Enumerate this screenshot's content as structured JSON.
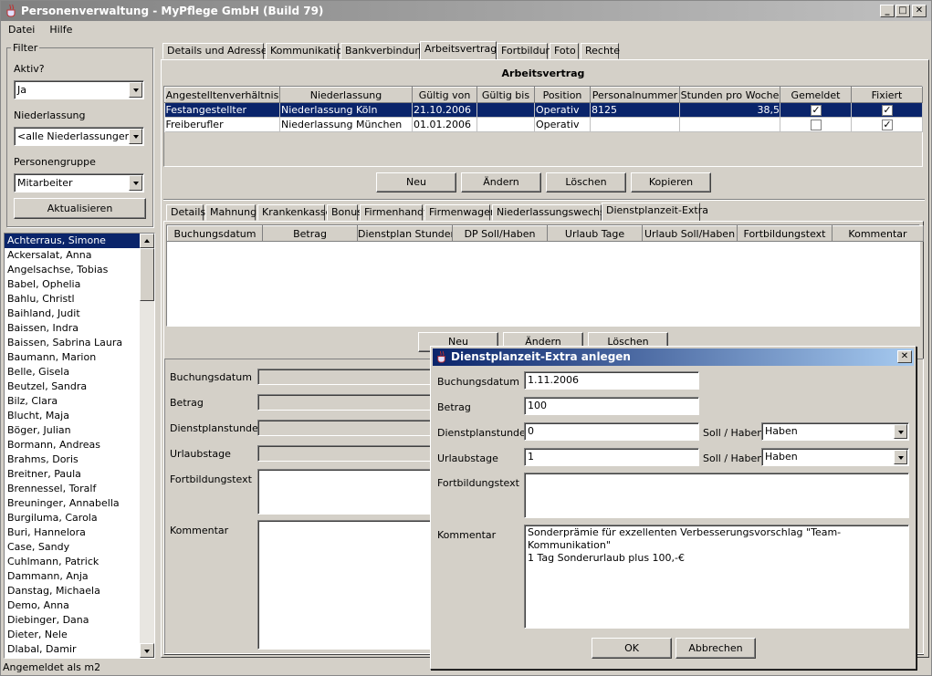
{
  "window": {
    "title": "Personenverwaltung - MyPflege GmbH (Build 79)",
    "min": "_",
    "max": "□",
    "close": "✕"
  },
  "menu": [
    "Datei",
    "Hilfe"
  ],
  "filter": {
    "title": "Filter",
    "aktiv_label": "Aktiv?",
    "aktiv_value": "Ja",
    "niederlassung_label": "Niederlassung",
    "niederlassung_value": "<alle Niederlassungen>",
    "gruppe_label": "Personengruppe",
    "gruppe_value": "Mitarbeiter",
    "refresh": "Aktualisieren"
  },
  "persons": [
    "Achterraus, Simone",
    "Ackersalat, Anna",
    "Angelsachse, Tobias",
    "Babel, Ophelia",
    "Bahlu, Christl",
    "Baihland, Judit",
    "Baissen, Indra",
    "Baissen, Sabrina Laura",
    "Baumann, Marion",
    "Belle, Gisela",
    "Beutzel, Sandra",
    "Bilz, Clara",
    "Blucht, Maja",
    "Böger, Julian",
    "Bormann, Andreas",
    "Brahms, Doris",
    "Breitner, Paula",
    "Brennessel, Toralf",
    "Breuninger, Annabella",
    "Burgiluma, Carola",
    "Buri, Hannelora",
    "Case, Sandy",
    "Cuhlmann, Patrick",
    "Dammann, Anja",
    "Danstag, Michaela",
    "Demo, Anna",
    "Diebinger, Dana",
    "Dieter, Nele",
    "Dlabal, Damir"
  ],
  "status": "Angemeldet als m2",
  "tabs": [
    "Details und Adressen",
    "Kommunikation",
    "Bankverbindung",
    "Arbeitsvertrag",
    "Fortbildung",
    "Foto",
    "Rechte"
  ],
  "contract": {
    "title": "Arbeitsvertrag",
    "columns": [
      "Angestelltenverhältnis",
      "Niederlassung",
      "Gültig von",
      "Gültig bis",
      "Position",
      "Personalnummer",
      "Stunden pro Woche",
      "Gemeldet",
      "Fixiert"
    ],
    "rows": [
      {
        "type": "Festangestellter",
        "branch": "Niederlassung Köln",
        "from": "21.10.2006",
        "to": "",
        "position": "Operativ",
        "pnr": "8125",
        "hours": "38,5",
        "gemeldet": true,
        "fixiert": true
      },
      {
        "type": "Freiberufler",
        "branch": "Niederlassung München",
        "from": "01.01.2006",
        "to": "",
        "position": "Operativ",
        "pnr": "",
        "hours": "",
        "gemeldet": false,
        "fixiert": true
      }
    ],
    "buttons": {
      "neu": "Neu",
      "aendern": "Ändern",
      "loeschen": "Löschen",
      "kopieren": "Kopieren"
    }
  },
  "subtabs": [
    "Details",
    "Mahnung",
    "Krankenkasse",
    "Bonus",
    "Firmenhandy",
    "Firmenwagen",
    "Niederlassungswechsel",
    "Dienstplanzeit-Extra"
  ],
  "extra": {
    "columns": [
      "Buchungsdatum",
      "Betrag",
      "Dienstplan Stunden",
      "DP Soll/Haben",
      "Urlaub Tage",
      "Urlaub Soll/Haben",
      "Fortbildungstext",
      "Kommentar"
    ],
    "buttons": {
      "neu": "Neu",
      "aendern": "Ändern",
      "loeschen": "Löschen"
    },
    "labels": {
      "buchung": "Buchungsdatum",
      "betrag": "Betrag",
      "stunden": "Dienstplanstunden",
      "urlaub": "Urlaubstage",
      "fortbildung": "Fortbildungstext",
      "kommentar": "Kommentar"
    }
  },
  "dialog": {
    "title": "Dienstplanzeit-Extra anlegen",
    "labels": {
      "buchung": "Buchungsdatum",
      "betrag": "Betrag",
      "stunden": "Dienstplanstunden",
      "urlaub": "Urlaubstage",
      "soll1": "Soll / Haben",
      "soll2": "Soll / Haben",
      "fortbildung": "Fortbildungstext",
      "kommentar": "Kommentar"
    },
    "values": {
      "buchung": "1.11.2006",
      "betrag": "100",
      "stunden": "0",
      "urlaub": "1",
      "soll1": "Haben",
      "soll2": "Haben",
      "fortbildung": "",
      "kommentar_line1": "Sonderprämie für exzellenten Verbesserungsvorschlag \"Team-Kommunikation\"",
      "kommentar_line2": "1 Tag Sonderurlaub plus 100,-€"
    },
    "ok": "OK",
    "cancel": "Abbrechen"
  }
}
